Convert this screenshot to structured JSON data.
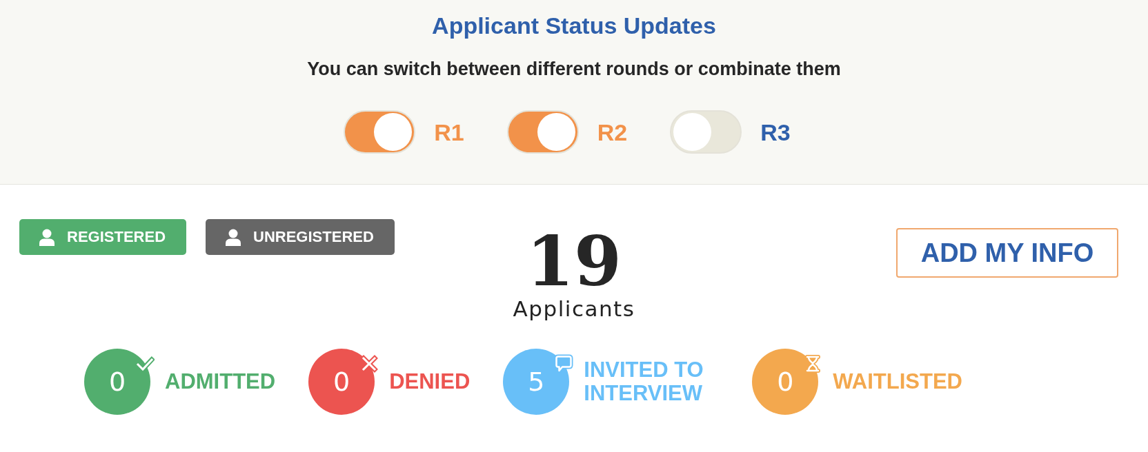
{
  "header": {
    "title": "Applicant Status Updates",
    "subtitle": "You can switch between different rounds or combinate them"
  },
  "rounds": [
    {
      "label": "R1",
      "on": true
    },
    {
      "label": "R2",
      "on": true
    },
    {
      "label": "R3",
      "on": false
    }
  ],
  "filters": [
    {
      "label": "REGISTERED",
      "color": "#52ae6e"
    },
    {
      "label": "UNREGISTERED",
      "color": "#666666"
    }
  ],
  "summary": {
    "count": "19",
    "label": "Applicants"
  },
  "add_button": {
    "label": "ADD MY INFO"
  },
  "statuses": [
    {
      "kind": "admitted",
      "count": "0",
      "label": "ADMITTED",
      "color": "#52ae6e"
    },
    {
      "kind": "denied",
      "count": "0",
      "label": "DENIED",
      "color": "#ec5450"
    },
    {
      "kind": "invited",
      "count": "5",
      "label": "INVITED TO INTERVIEW",
      "color": "#68bff8"
    },
    {
      "kind": "waitlisted",
      "count": "0",
      "label": "WAITLISTED",
      "color": "#f3a84e"
    }
  ]
}
